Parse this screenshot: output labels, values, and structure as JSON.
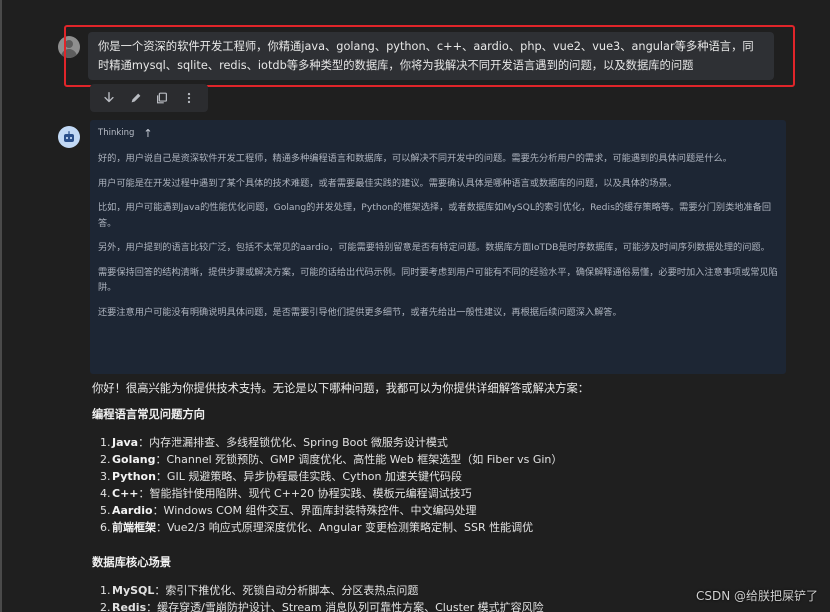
{
  "user_message": {
    "text": "你是一个资深的软件开发工程师，你精通java、golang、python、c++、aardio、php、vue2、vue3、angular等多种语言，同时精通mysql、sqlite、redis、iotdb等多种类型的数据库，你将为我解决不同开发语言遇到的问题，以及数据库的问题"
  },
  "actions": [
    {
      "icon": "download-icon"
    },
    {
      "icon": "edit-icon"
    },
    {
      "icon": "copy-icon"
    },
    {
      "icon": "more-vertical-icon"
    }
  ],
  "thinking": {
    "label": "Thinking",
    "paragraphs": [
      "好的，用户说自己是资深软件开发工程师，精通多种编程语言和数据库，可以解决不同开发中的问题。需要先分析用户的需求，可能遇到的具体问题是什么。",
      "用户可能是在开发过程中遇到了某个具体的技术难题，或者需要最佳实践的建议。需要确认具体是哪种语言或数据库的问题，以及具体的场景。",
      "比如，用户可能遇到Java的性能优化问题，Golang的并发处理，Python的框架选择，或者数据库如MySQL的索引优化，Redis的缓存策略等。需要分门别类地准备回答。",
      "另外，用户提到的语言比较广泛，包括不太常见的aardio，可能需要特别留意是否有特定问题。数据库方面IoTDB是时序数据库，可能涉及时间序列数据处理的问题。",
      "需要保持回答的结构清晰，提供步骤或解决方案，可能的话给出代码示例。同时要考虑到用户可能有不同的经验水平，确保解释通俗易懂，必要时加入注意事项或常见陷阱。",
      "还要注意用户可能没有明确说明具体问题，是否需要引导他们提供更多细节，或者先给出一般性建议，再根据后续问题深入解答。"
    ]
  },
  "answer": {
    "intro": "你好！很高兴能为你提供技术支持。无论是以下哪种问题，我都可以为你提供详细解答或解决方案：",
    "section1_title": "编程语言常见问题方向",
    "section1_items": [
      {
        "num": "1.",
        "name": "Java",
        "desc": "：内存泄漏排查、多线程锁优化、Spring Boot 微服务设计模式"
      },
      {
        "num": "2.",
        "name": "Golang",
        "desc": "：Channel 死锁预防、GMP 调度优化、高性能 Web 框架选型（如 Fiber vs Gin）"
      },
      {
        "num": "3.",
        "name": "Python",
        "desc": "：GIL 规避策略、异步协程最佳实践、Cython 加速关键代码段"
      },
      {
        "num": "4.",
        "name": "C++",
        "desc": "：智能指针使用陷阱、现代 C++20 协程实践、模板元编程调试技巧"
      },
      {
        "num": "5.",
        "name": "Aardio",
        "desc": "：Windows COM 组件交互、界面库封装特殊控件、中文编码处理"
      },
      {
        "num": "6.",
        "name": "前端框架",
        "desc": "：Vue2/3 响应式原理深度优化、Angular 变更检测策略定制、SSR 性能调优"
      }
    ],
    "section2_title": "数据库核心场景",
    "section2_items": [
      {
        "num": "1.",
        "name": "MySQL",
        "desc": "：索引下推优化、死锁自动分析脚本、分区表热点问题"
      },
      {
        "num": "2.",
        "name": "Redis",
        "desc": "：缓存穿透/雪崩防护设计、Stream 消息队列可靠性方案、Cluster 模式扩容风险"
      }
    ]
  },
  "watermark": "CSDN @给朕把屎铲了"
}
